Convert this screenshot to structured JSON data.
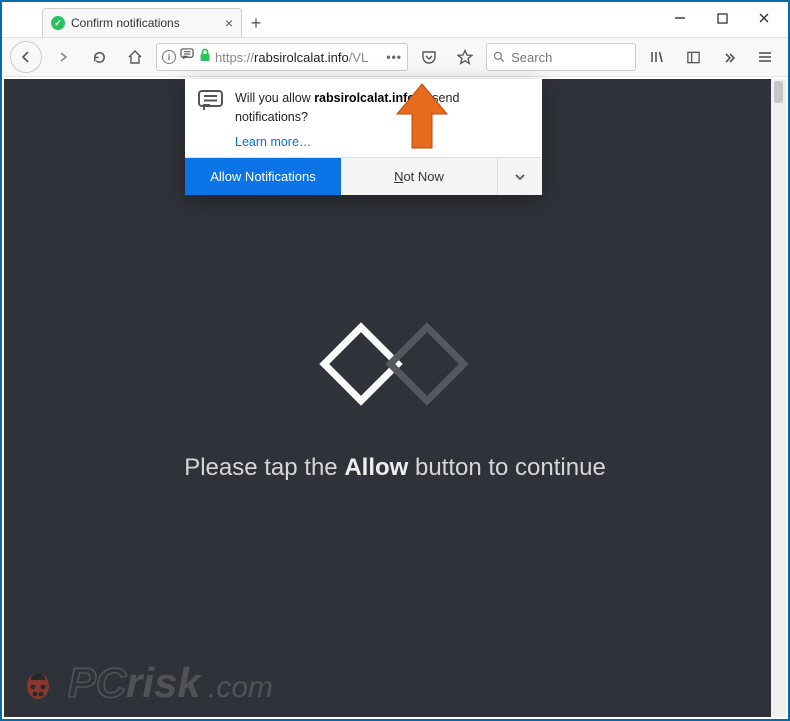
{
  "colors": {
    "accent": "#0b74e6",
    "frame": "#0a6aa8",
    "content_bg": "#2f3339",
    "lock": "#2ac15f"
  },
  "tab": {
    "title": "Confirm notifications"
  },
  "window_controls": {
    "minimize": "minimize",
    "maximize": "maximize",
    "close": "close"
  },
  "url": {
    "scheme": "https://",
    "host": "rabsirolcalat.info",
    "path": "/VL"
  },
  "actions": {
    "dots": "•••"
  },
  "search": {
    "placeholder": "Search"
  },
  "doorhanger": {
    "prefix": "Will you allow ",
    "domain": "rabsirolcalat.info",
    "suffix": " to send notifications?",
    "learn": "Learn more…",
    "allow": "Allow Notifications",
    "notnow_u": "N",
    "notnow_rest": "ot Now"
  },
  "page": {
    "msg_pre": "Please tap the ",
    "msg_bold": "Allow",
    "msg_post": " button to continue"
  },
  "watermark": {
    "brand_pc": "PC",
    "brand_risk": "risk",
    "brand_tld": ".com"
  }
}
